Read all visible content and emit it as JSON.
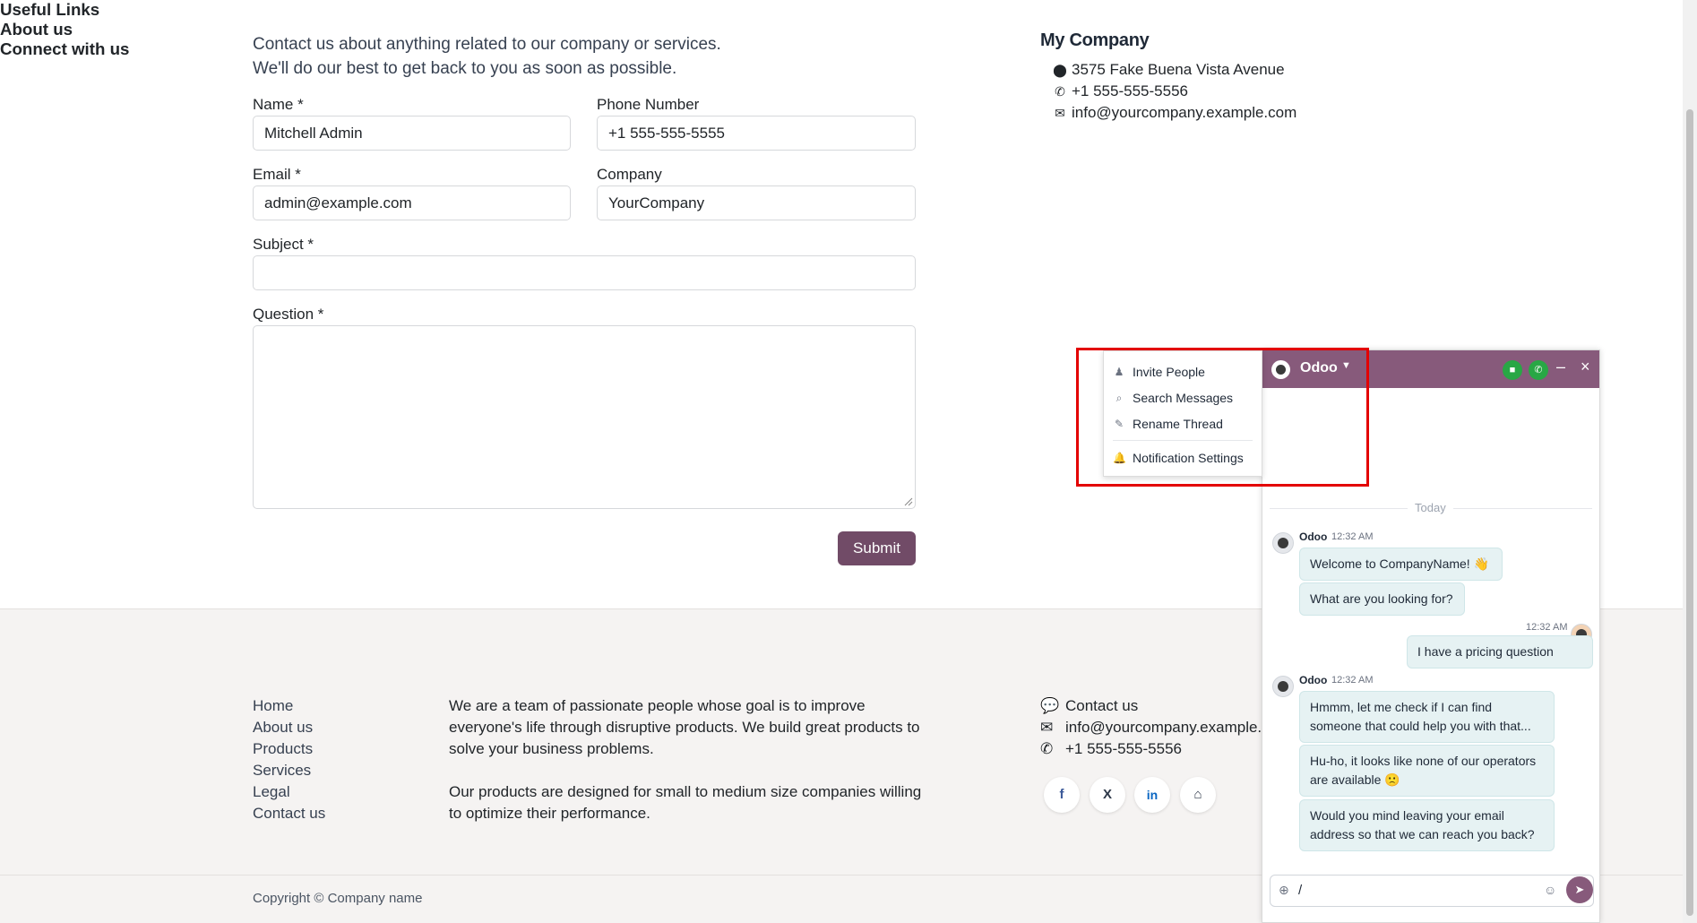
{
  "contact": {
    "intro_line1": "Contact us about anything related to our company or services.",
    "intro_line2": "We'll do our best to get back to you as soon as possible.",
    "name_label": "Name *",
    "name_value": "Mitchell Admin",
    "phone_label": "Phone Number",
    "phone_value": "+1 555-555-5555",
    "email_label": "Email *",
    "email_value": "admin@example.com",
    "company_label": "Company",
    "company_value": "YourCompany",
    "subject_label": "Subject *",
    "subject_value": "",
    "question_label": "Question *",
    "question_value": "",
    "submit_label": "Submit"
  },
  "company_info": {
    "title": "My Company",
    "address": "3575 Fake Buena Vista Avenue",
    "phone": "+1 555-555-5556",
    "email": "info@yourcompany.example.com"
  },
  "footer": {
    "useful_links_title": "Useful Links",
    "links": [
      "Home",
      "About us",
      "Products",
      "Services",
      "Legal",
      "Contact us"
    ],
    "about_title": "About us",
    "about_p1": "We are a team of passionate people whose goal is to improve everyone's life through disruptive products. We build great products to solve your business problems.",
    "about_p2": "Our products are designed for small to medium size companies willing to optimize their performance.",
    "connect_title": "Connect with us",
    "connect_contact": "Contact us",
    "connect_email": "info@yourcompany.example.com",
    "connect_phone": "+1 555-555-5556",
    "social": [
      "f",
      "X",
      "in",
      "⌂"
    ],
    "copyright": "Copyright © Company name"
  },
  "chat": {
    "title": "Odoo",
    "today_label": "Today",
    "messages": [
      {
        "author": "Odoo",
        "time": "12:32 AM",
        "text": "Welcome to CompanyName! 👋"
      },
      {
        "text": "What are you looking for?"
      },
      {
        "time": "12:32 AM",
        "text": "I have a pricing question"
      },
      {
        "author": "Odoo",
        "time": "12:32 AM",
        "text": "Hmmm, let me check if I can find someone that could help you with that..."
      },
      {
        "text": "Hu-ho, it looks like none of our operators are available 🙁"
      },
      {
        "text": "Would you mind leaving your email address so that we can reach you back?"
      }
    ],
    "composer_value": "/"
  },
  "dropdown": {
    "items": [
      "Invite People",
      "Search Messages",
      "Rename Thread",
      "Notification Settings"
    ]
  },
  "colors": {
    "brand": "#714b67",
    "chat_header": "#875a7b",
    "call_buttons": "#28a745",
    "highlight": "#e30000"
  }
}
